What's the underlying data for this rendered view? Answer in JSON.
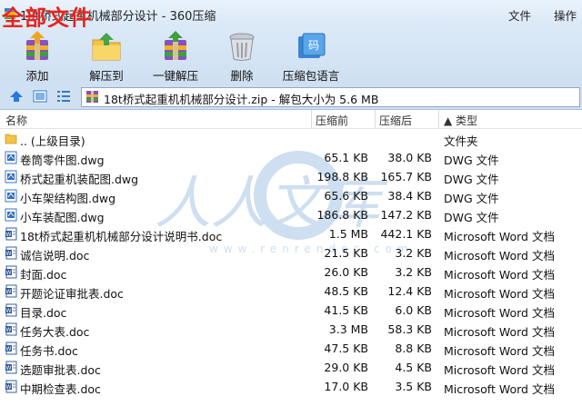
{
  "window": {
    "title": "18t桥式起重机械部分设计 - 360压缩",
    "overlay_label": "全部文件",
    "menu": [
      "文件",
      "操作"
    ]
  },
  "toolbar": {
    "buttons": [
      {
        "label": "添加",
        "icon": "add-archive-icon"
      },
      {
        "label": "解压到",
        "icon": "extract-folder-icon"
      },
      {
        "label": "一键解压",
        "icon": "one-click-extract-icon"
      },
      {
        "label": "删除",
        "icon": "trash-can-icon"
      },
      {
        "label": "压缩包语言",
        "icon": "archive-language-icon"
      }
    ]
  },
  "address": {
    "text": "18t桥式起重机机械部分设计.zip - 解包大小为 5.6 MB"
  },
  "columns": {
    "name": "名称",
    "packed": "压缩前",
    "size": "压缩后",
    "type": "▲ 类型"
  },
  "files": [
    {
      "name": ".. (上级目录)",
      "packed": "",
      "size": "",
      "type": "文件夹",
      "icon": "folder-up-icon"
    },
    {
      "name": "卷筒零件图.dwg",
      "packed": "65.1 KB",
      "size": "38.0 KB",
      "type": "DWG 文件",
      "icon": "dwg-file-icon"
    },
    {
      "name": "桥式起重机装配图.dwg",
      "packed": "198.8 KB",
      "size": "165.7 KB",
      "type": "DWG 文件",
      "icon": "dwg-file-icon"
    },
    {
      "name": "小车架结构图.dwg",
      "packed": "65.6 KB",
      "size": "38.4 KB",
      "type": "DWG 文件",
      "icon": "dwg-file-icon"
    },
    {
      "name": "小车装配图.dwg",
      "packed": "186.8 KB",
      "size": "147.2 KB",
      "type": "DWG 文件",
      "icon": "dwg-file-icon"
    },
    {
      "name": "18t桥式起重机机械部分设计说明书.doc",
      "packed": "1.5 MB",
      "size": "442.1 KB",
      "type": "Microsoft Word 文档",
      "icon": "word-doc-icon"
    },
    {
      "name": "诚信说明.doc",
      "packed": "21.5 KB",
      "size": "3.2 KB",
      "type": "Microsoft Word 文档",
      "icon": "word-doc-icon"
    },
    {
      "name": "封面.doc",
      "packed": "26.0 KB",
      "size": "3.2 KB",
      "type": "Microsoft Word 文档",
      "icon": "word-doc-icon"
    },
    {
      "name": "开题论证审批表.doc",
      "packed": "48.5 KB",
      "size": "12.4 KB",
      "type": "Microsoft Word 文档",
      "icon": "word-doc-icon"
    },
    {
      "name": "目录.doc",
      "packed": "41.5 KB",
      "size": "6.0 KB",
      "type": "Microsoft Word 文档",
      "icon": "word-doc-icon"
    },
    {
      "name": "任务大表.doc",
      "packed": "3.3 MB",
      "size": "58.3 KB",
      "type": "Microsoft Word 文档",
      "icon": "word-doc-icon"
    },
    {
      "name": "任务书.doc",
      "packed": "47.5 KB",
      "size": "8.8 KB",
      "type": "Microsoft Word 文档",
      "icon": "word-doc-icon"
    },
    {
      "name": "选题审批表.doc",
      "packed": "29.0 KB",
      "size": "4.5 KB",
      "type": "Microsoft Word 文档",
      "icon": "word-doc-icon"
    },
    {
      "name": "中期检查表.doc",
      "packed": "17.0 KB",
      "size": "3.5 KB",
      "type": "Microsoft Word 文档",
      "icon": "word-doc-icon"
    }
  ],
  "watermark": {
    "text": "人人文库",
    "url": "www.renrendoc.com"
  },
  "colors": {
    "accent": "#2a6fc0",
    "overlay_red": "#e8231f",
    "toolbar_bg": "#d4e4f4"
  }
}
